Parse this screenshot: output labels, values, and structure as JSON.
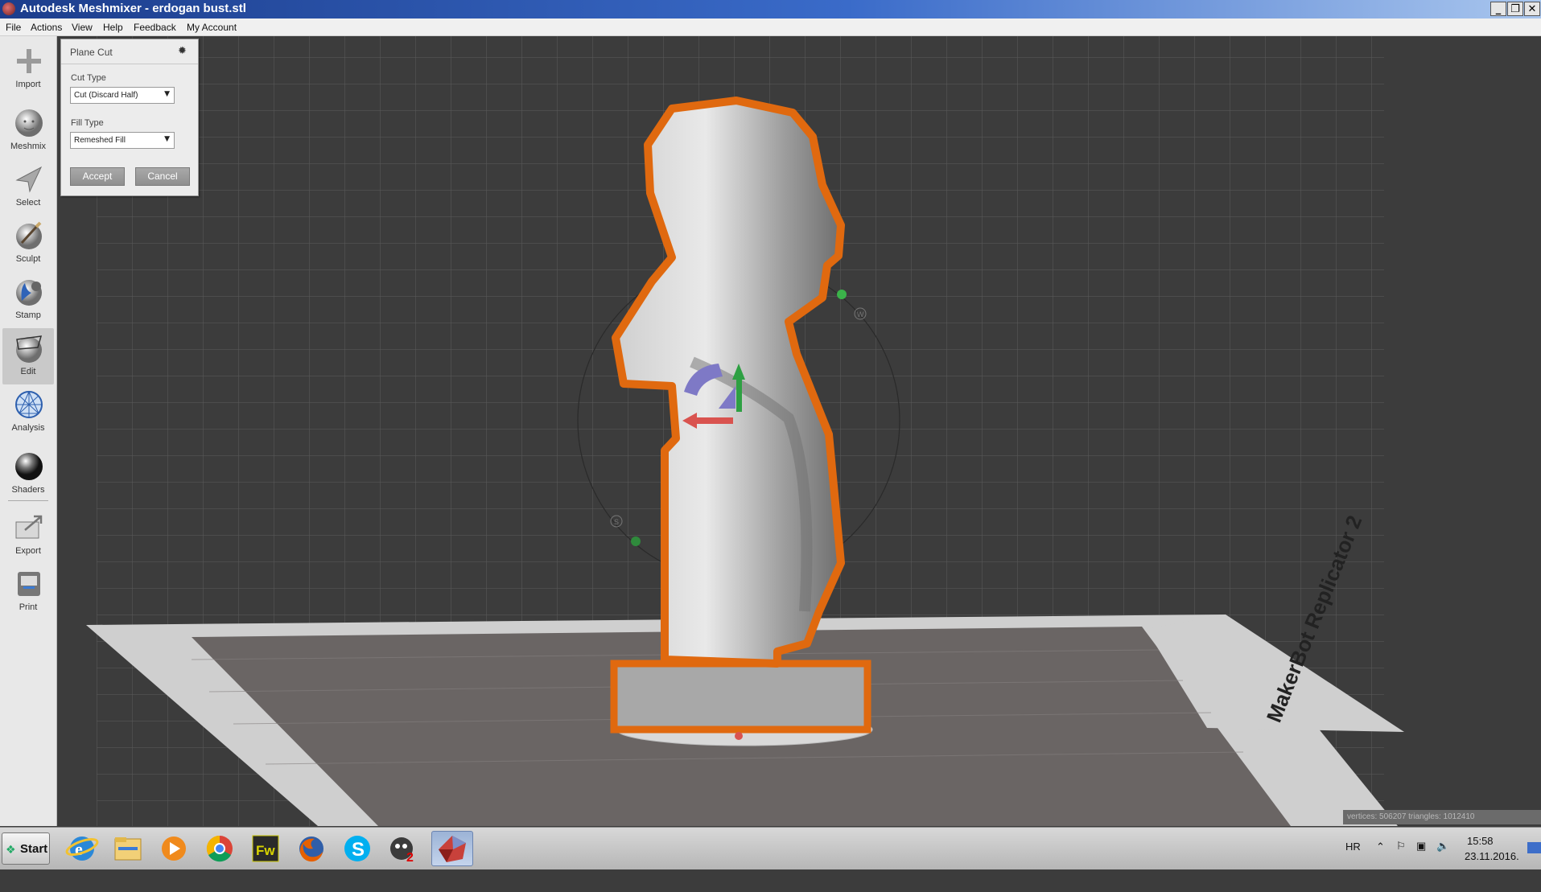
{
  "window": {
    "title": "Autodesk Meshmixer - erdogan bust.stl",
    "controls": {
      "minimize": "_",
      "maximize": "❐",
      "close": "✕"
    }
  },
  "menu": [
    "File",
    "Actions",
    "View",
    "Help",
    "Feedback",
    "My Account"
  ],
  "tools": [
    {
      "label": "Import",
      "icon": "import-icon"
    },
    {
      "label": "Meshmix",
      "icon": "meshmix-icon"
    },
    {
      "label": "Select",
      "icon": "select-icon"
    },
    {
      "label": "Sculpt",
      "icon": "sculpt-icon"
    },
    {
      "label": "Stamp",
      "icon": "stamp-icon"
    },
    {
      "label": "Edit",
      "icon": "edit-icon",
      "active": true
    },
    {
      "label": "Analysis",
      "icon": "analysis-icon"
    },
    {
      "label": "Shaders",
      "icon": "shaders-icon"
    },
    {
      "label": "Export",
      "icon": "export-icon"
    },
    {
      "label": "Print",
      "icon": "print-icon"
    }
  ],
  "plane_cut": {
    "title": "Plane Cut",
    "cut_type_label": "Cut Type",
    "cut_type_value": "Cut (Discard Half)",
    "fill_type_label": "Fill Type",
    "fill_type_value": "Remeshed Fill",
    "accept_label": "Accept",
    "cancel_label": "Cancel"
  },
  "viewport": {
    "build_plate_label": "MakerBot Replicator 2",
    "gizmo_handles": [
      "W",
      "S"
    ],
    "accent_color": "#e0690f"
  },
  "status": {
    "text": "vertices: 506207 triangles: 1012410"
  },
  "taskbar": {
    "start_label": "Start",
    "apps": [
      "internet-explorer-icon",
      "file-explorer-icon",
      "media-player-icon",
      "chrome-icon",
      "fireworks-icon",
      "firefox-icon",
      "skype-icon",
      "gimp-icon",
      "meshmixer-icon"
    ],
    "fireworks_label": "Fw",
    "language": "HR",
    "time": "15:58",
    "date": "23.11.2016."
  }
}
